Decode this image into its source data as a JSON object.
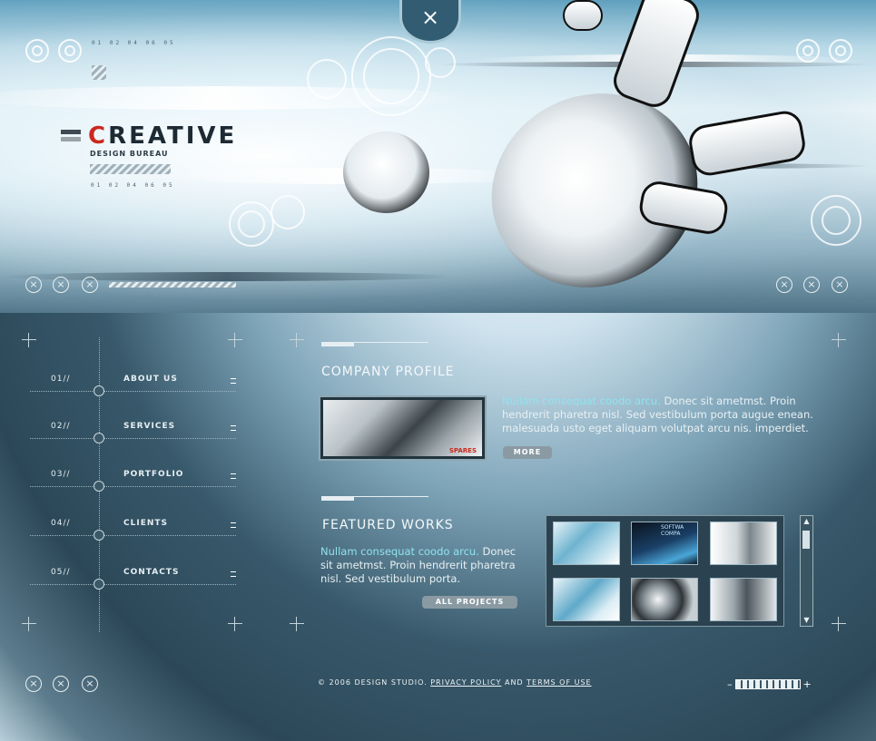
{
  "header": {
    "close_symbol": "×",
    "brand_first_letter": "C",
    "brand_rest": "REATIVE",
    "tagline": "DESIGN BUREAU",
    "tiny_numbers_top": "01 02 04 06 05",
    "tiny_numbers_logo": "01 02 04 06 05"
  },
  "nav": {
    "items": [
      {
        "num": "01//",
        "label": "ABOUT US"
      },
      {
        "num": "02//",
        "label": "SERVICES"
      },
      {
        "num": "03//",
        "label": "PORTFOLIO"
      },
      {
        "num": "04//",
        "label": "CLIENTS"
      },
      {
        "num": "05//",
        "label": "CONTACTS"
      }
    ]
  },
  "company_profile": {
    "title": "COMPANY PROFILE",
    "lead": "Nullam consequat coodo arcu.",
    "body": " Donec sit ametmst. Proin hendrerit pharetra nisl. Sed vestibulum porta augue enean. malesuada usto eget aliquam volutpat arcu nis. imperdiet.",
    "more_label": "MORE",
    "thumb_caption": "SPARES"
  },
  "featured_works": {
    "title": "FEATURED WORKS",
    "lead": "Nullam consequat coodo arcu.",
    "body": " Donec sit ametmst. Proin hendrerit pharetra nisl. Sed vestibulum porta.",
    "all_projects_label": "ALL PROJECTS",
    "thumb2_caption": "SOFTWA COMPA"
  },
  "footer": {
    "copyright": "© 2006 DESIGN STUDIO.",
    "privacy_label": "PRIVACY POLICY",
    "and_text": "AND",
    "terms_label": "TERMS OF USE",
    "vol_minus": "–",
    "vol_plus": "+"
  },
  "colors": {
    "brand_red": "#c92a1e",
    "accent_cyan": "#8fe3ef",
    "panel_bg": "#2c4858"
  },
  "icons": [
    "close-icon",
    "ring-icon",
    "x-circle-icon",
    "crosshair-icon",
    "scroll-up-icon",
    "scroll-down-icon"
  ]
}
